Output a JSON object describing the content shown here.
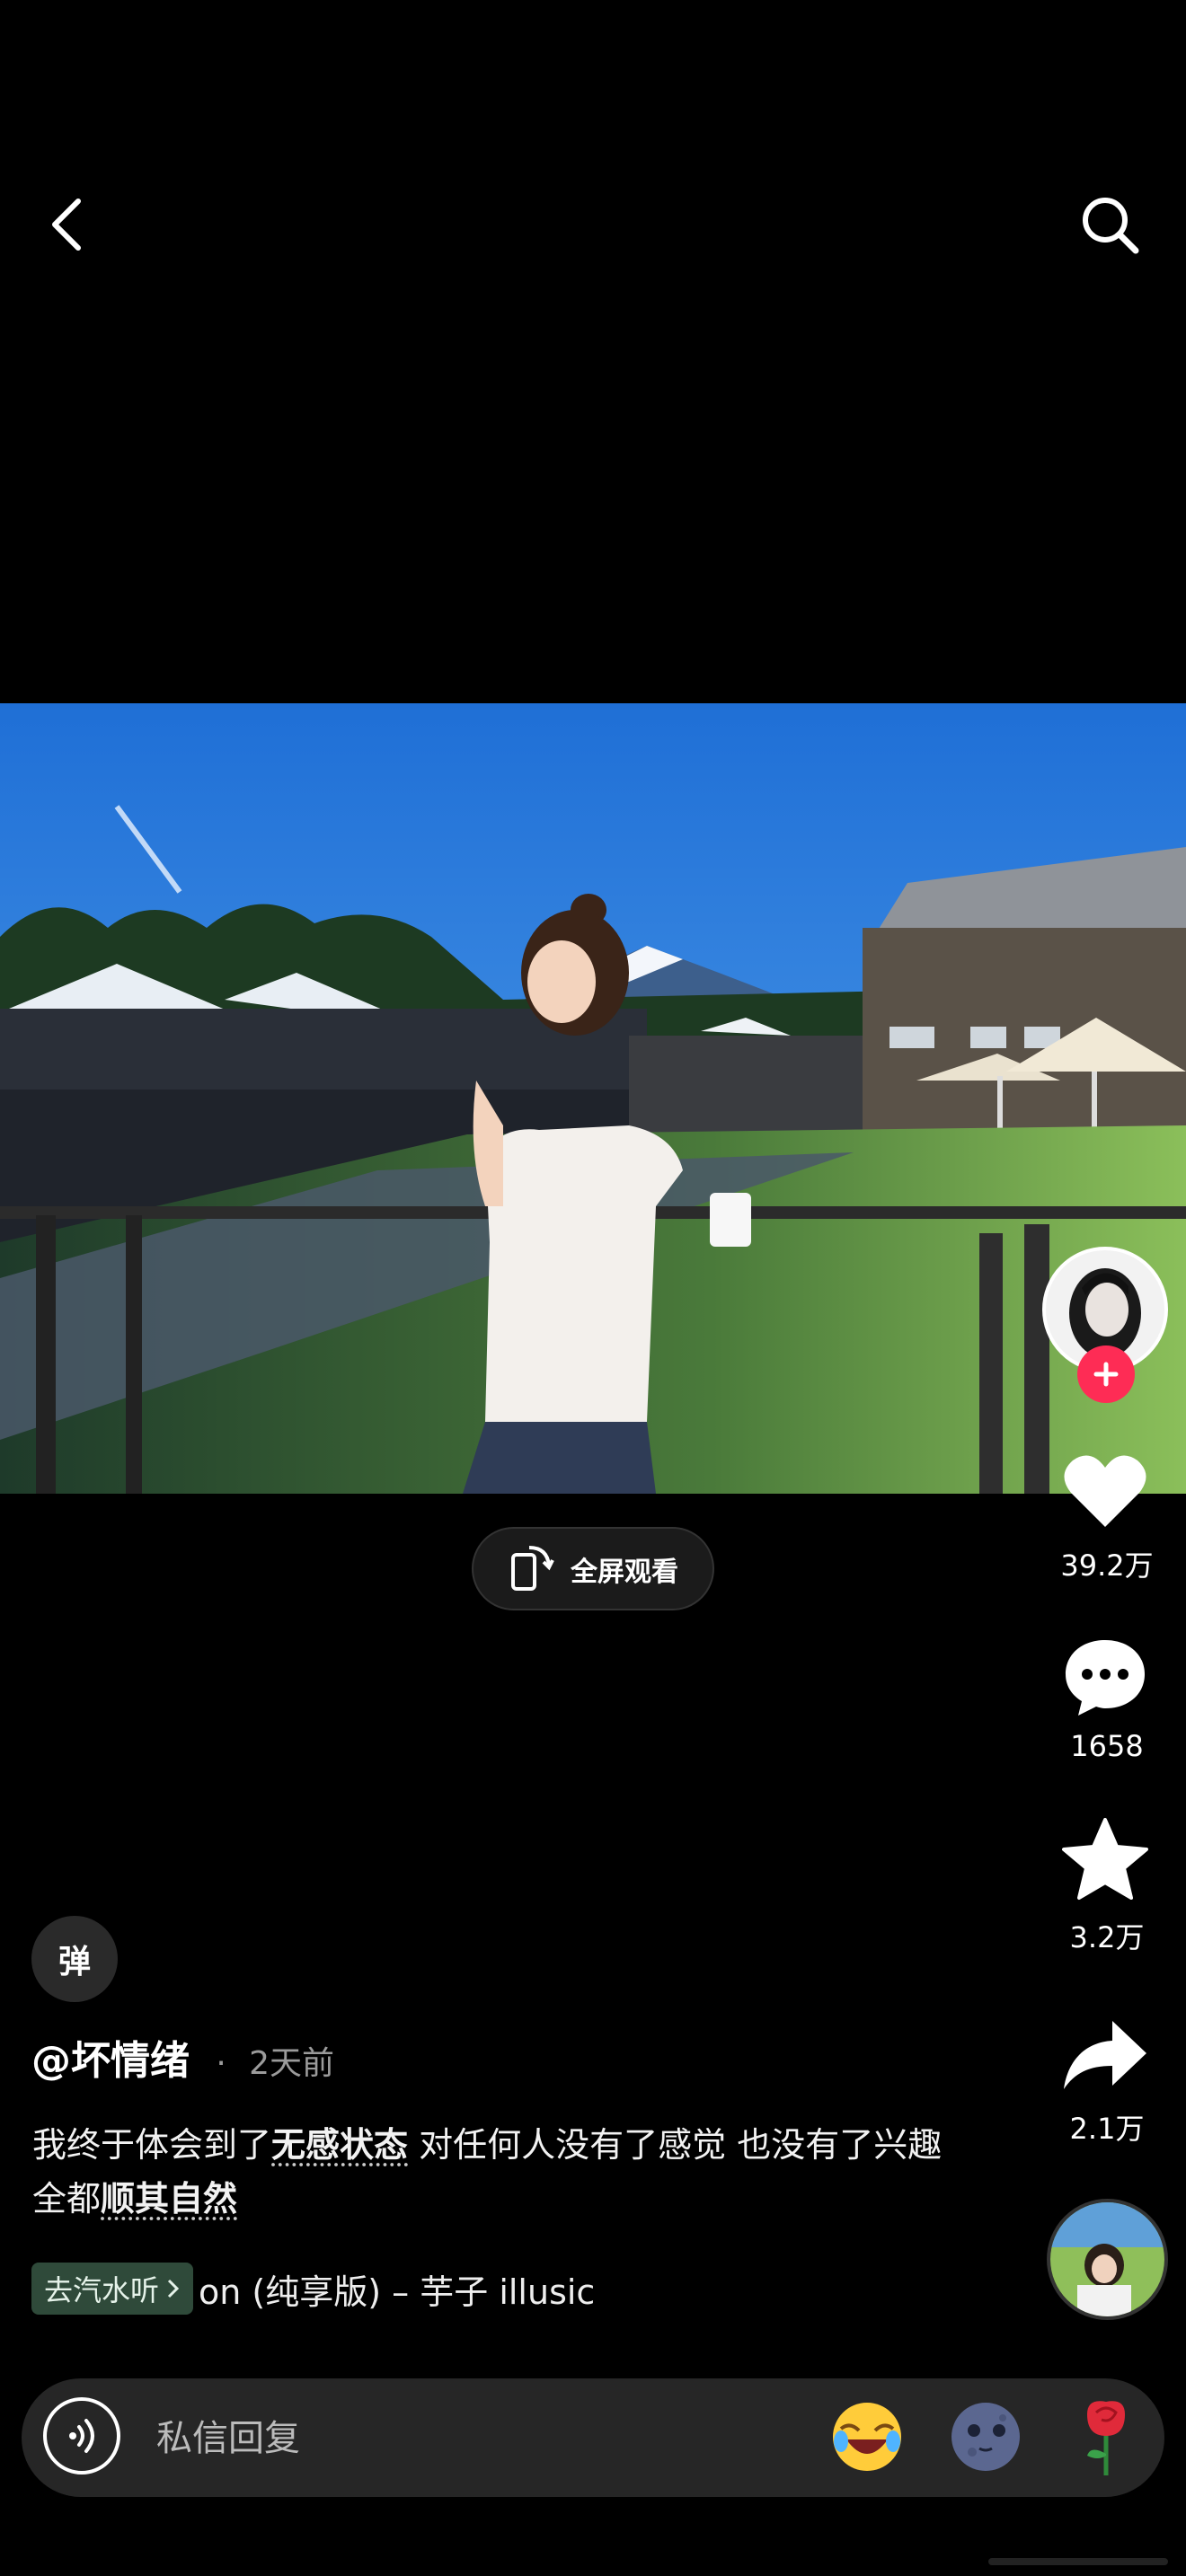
{
  "top_bar": {
    "back_icon": "chevron-left-icon",
    "search_icon": "search-icon"
  },
  "video": {
    "description_icon": "video-frame"
  },
  "fullscreen": {
    "label": "全屏观看",
    "icon": "rotate-phone-icon"
  },
  "rail": {
    "avatar_icon": "author-avatar",
    "follow_icon": "plus-icon",
    "like_count": "39.2万",
    "comment_count": "1658",
    "favorite_count": "3.2万",
    "share_count": "2.1万"
  },
  "danmaku": {
    "label": "弹"
  },
  "author": {
    "handle": "@坏情绪",
    "separator": "·",
    "time": "2天前"
  },
  "caption": {
    "part1": "我终于体会到了",
    "keyword1": "无感状态",
    "part2": " 对任何人没有了感觉 也没有了兴趣 全都",
    "keyword2": "顺其自然"
  },
  "music": {
    "tag": "去汽水听",
    "title": "on (纯享版) – 芋子    illusic"
  },
  "reply": {
    "placeholder": "私信回复"
  },
  "colors": {
    "accent": "#fe2c55",
    "background": "#000000",
    "bar": "#262626",
    "tag_bg": "#2f4a3a"
  }
}
